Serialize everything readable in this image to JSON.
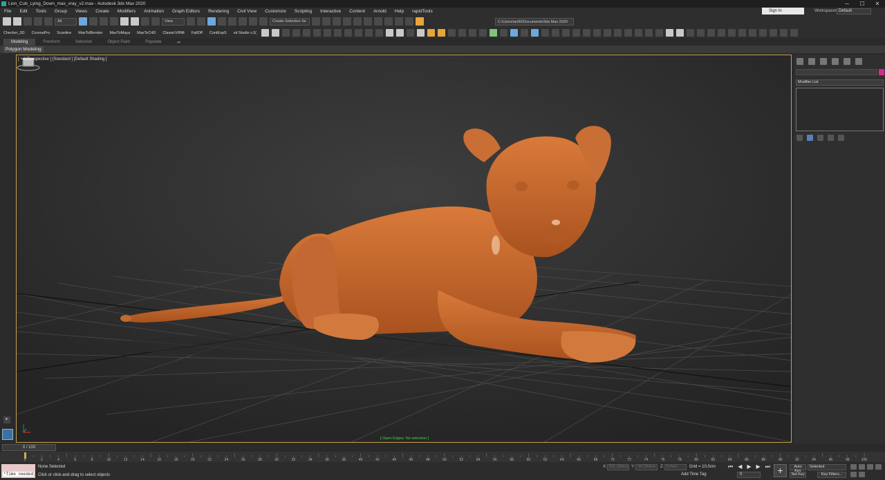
{
  "window": {
    "title": "Lion_Cub_Lying_Down_max_vray_v2.max - Autodesk 3ds Max 2020",
    "minimize": "─",
    "maximize": "☐",
    "close": "✕"
  },
  "menu": {
    "items": [
      "File",
      "Edit",
      "Tools",
      "Group",
      "Views",
      "Create",
      "Modifiers",
      "Animation",
      "Graph Editors",
      "Rendering",
      "Civil View",
      "Customize",
      "Scripting",
      "Interactive",
      "Content",
      "Arnold",
      "Help",
      "rapidTools"
    ],
    "signin": "Sign In",
    "workspaces_label": "Workspaces:",
    "workspaces_value": "Default"
  },
  "toolbar": {
    "filter_select": "All",
    "view_select": "View",
    "selection_set": "Create Selection Se",
    "project_path": "C:\\Users\\art30\\Documents\\3ds Max 2020"
  },
  "plugins": [
    "Checker_3D",
    "CoronaPro",
    "Scanline",
    "MaxToBlender",
    "MaxToMaya",
    "MaxToC4D",
    "ClassicVRMt",
    "FallOff",
    "ContExpS",
    "xd Studio v.2("
  ],
  "ribbon": {
    "tabs": [
      "Modeling",
      "Freeform",
      "Selection",
      "Object Paint",
      "Populate"
    ],
    "active_tab": "Modeling",
    "sub_label": "Polygon Modeling"
  },
  "viewport": {
    "label": "[ + ] [Perspective ] [Standard ] [Default Shading ]",
    "status": "[ Open Edges: No selection ]"
  },
  "command_panel": {
    "modifier_list": "Modifier List"
  },
  "timeline": {
    "slider_label": "0 / 100",
    "ticks": [
      "0",
      "2",
      "4",
      "6",
      "8",
      "10",
      "12",
      "14",
      "16",
      "18",
      "20",
      "22",
      "24",
      "26",
      "28",
      "30",
      "32",
      "34",
      "36",
      "38",
      "40",
      "42",
      "44",
      "46",
      "48",
      "50",
      "52",
      "54",
      "56",
      "58",
      "60",
      "62",
      "64",
      "66",
      "68",
      "70",
      "72",
      "74",
      "76",
      "78",
      "80",
      "82",
      "84",
      "86",
      "88",
      "90",
      "92",
      "94",
      "96",
      "98",
      "100"
    ]
  },
  "status": {
    "maxscript_text": "*Time needed",
    "selection": "None Selected",
    "prompt": "Click or click-and-drag to select objects",
    "x_label": "X:",
    "x_value": "521,193cm",
    "y_label": "Y:",
    "y_value": "-97,254cm",
    "z_label": "Z:",
    "z_value": "0,0cm",
    "grid": "Grid = 10,0cm",
    "add_time_tag": "Add Time Tag",
    "frame": "0",
    "auto_key": "Auto Key",
    "set_key": "Set Key",
    "selected_dd": "Selected",
    "key_filters": "Key Filters..."
  },
  "colors": {
    "viewport_border": "#c8a44a",
    "model": "#c86a2e",
    "status_green": "#4bd34b",
    "color_swatch": "#d22d8e"
  }
}
